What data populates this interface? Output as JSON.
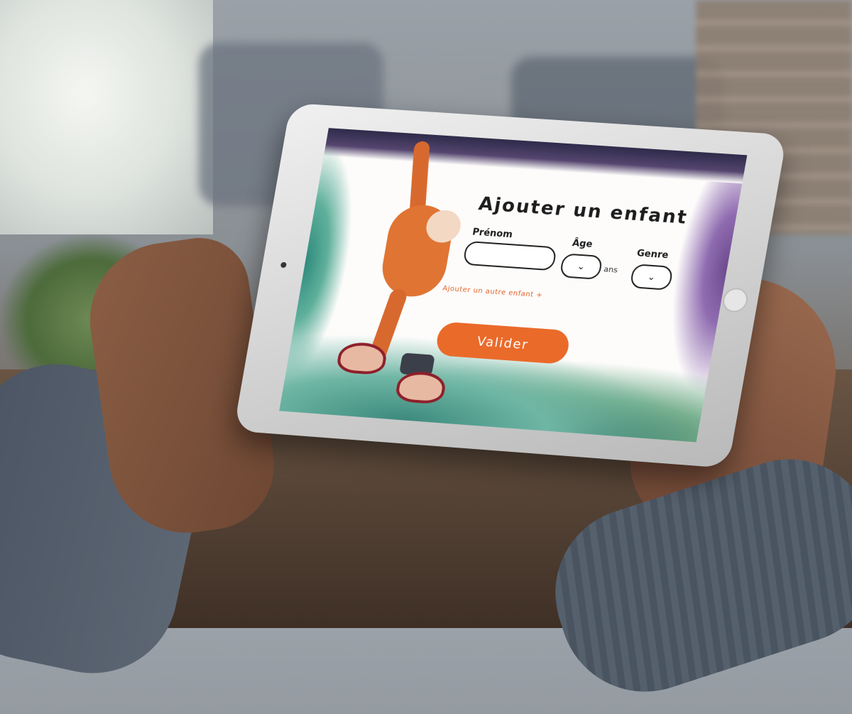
{
  "form": {
    "title": "Ajouter un enfant",
    "prenom_label": "Prénom",
    "prenom_value": "",
    "age_label": "Âge",
    "age_unit": "ans",
    "genre_label": "Genre",
    "add_child_link": "Ajouter un autre enfant +",
    "submit_label": "Valider"
  },
  "icons": {
    "age_select": "chevron-down-icon",
    "genre_select": "chevron-down-icon"
  },
  "colors": {
    "accent": "#ea6a2a",
    "text": "#1d1d1d"
  }
}
